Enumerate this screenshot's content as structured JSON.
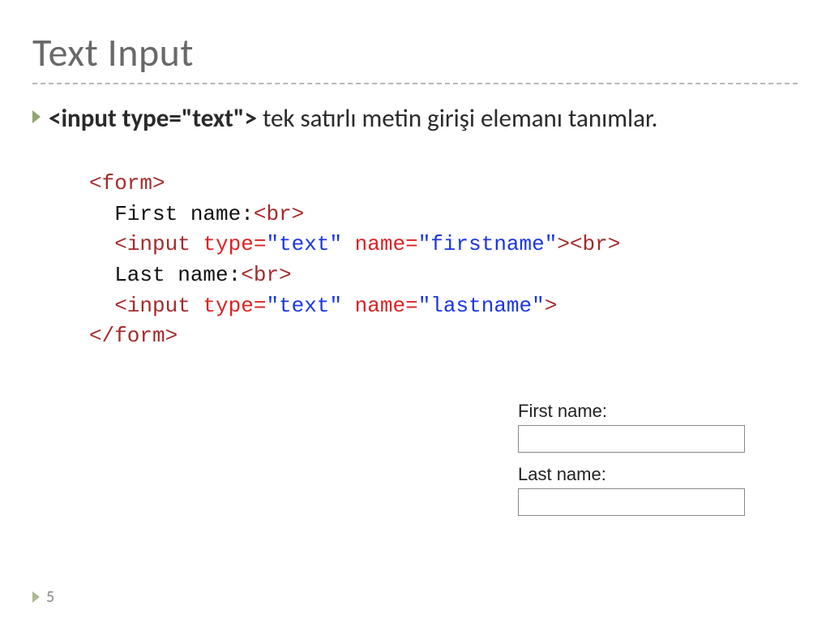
{
  "title": "Text Input",
  "bullet": {
    "code": "<input type=\"text\">",
    "text": " tek satırlı metin girişi elemanı tanımlar."
  },
  "code": {
    "l1_open": "<form>",
    "l2_txt": "  First name:",
    "l2_br": "<br>",
    "l3_open": "  <input",
    "l3_a1n": " type=",
    "l3_a1v": "\"text\"",
    "l3_a2n": " name=",
    "l3_a2v": "\"firstname\"",
    "l3_close": ">",
    "l3_br": "<br>",
    "l4_txt": "  Last name:",
    "l4_br": "<br>",
    "l5_open": "  <input",
    "l5_a1n": " type=",
    "l5_a1v": "\"text\"",
    "l5_a2n": " name=",
    "l5_a2v": "\"lastname\"",
    "l5_close": ">",
    "l6_close": "</form>"
  },
  "preview": {
    "first_label": "First name:",
    "last_label": "Last name:"
  },
  "page_number": "5"
}
